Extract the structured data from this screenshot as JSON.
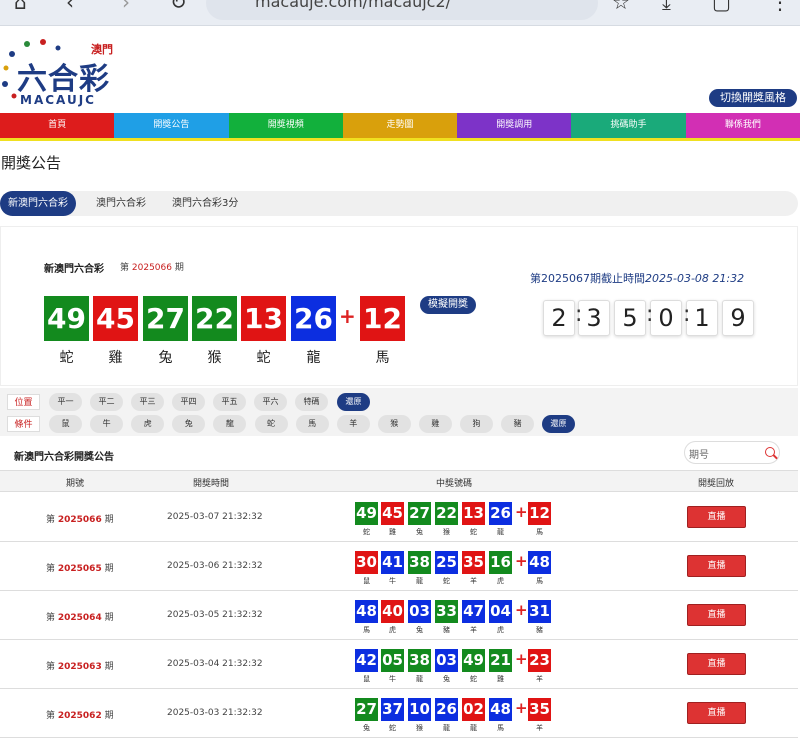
{
  "browser": {
    "url": "macauje.com/macaujc2/"
  },
  "logo": {
    "brand_cn": "六合彩",
    "region": "澳門",
    "brand_en": "MACAUJC"
  },
  "style_switch": "切換開獎風格",
  "nav": [
    {
      "label": "首頁",
      "color": "#dd1c1c"
    },
    {
      "label": "開獎公告",
      "color": "#1f9fe6"
    },
    {
      "label": "開獎視頻",
      "color": "#12b03c"
    },
    {
      "label": "走勢圖",
      "color": "#d9a00c"
    },
    {
      "label": "開獎調用",
      "color": "#7d33c8"
    },
    {
      "label": "挑碼助手",
      "color": "#1aaa7a"
    },
    {
      "label": "聯係我們",
      "color": "#d22fb4"
    }
  ],
  "page_title": "開獎公告",
  "tabs": [
    "新澳門六合彩",
    "澳門六合彩",
    "澳門六合彩3分"
  ],
  "current": {
    "lottery_name": "新澳門六合彩",
    "issue_prefix": "第",
    "issue": "2025066",
    "issue_suffix": "期",
    "balls": [
      {
        "num": "49",
        "zodiac": "蛇",
        "color": "#138a1e"
      },
      {
        "num": "45",
        "zodiac": "雞",
        "color": "#e01414"
      },
      {
        "num": "27",
        "zodiac": "兔",
        "color": "#138a1e"
      },
      {
        "num": "22",
        "zodiac": "猴",
        "color": "#138a1e"
      },
      {
        "num": "13",
        "zodiac": "蛇",
        "color": "#e01414"
      },
      {
        "num": "26",
        "zodiac": "龍",
        "color": "#0c2ee0"
      }
    ],
    "special": {
      "num": "12",
      "zodiac": "馬",
      "color": "#e01414"
    },
    "plus": "+",
    "simulate_label": "模擬開獎",
    "deadline_text": "第2025067期截止時間",
    "deadline_time": "2025-03-08 21:32",
    "countdown": [
      "2",
      "3",
      "5",
      "0",
      "1",
      "9"
    ]
  },
  "filters": {
    "position_label": "位置",
    "position_chips": [
      "平一",
      "平二",
      "平三",
      "平四",
      "平五",
      "平六",
      "特碼"
    ],
    "reset": "還原",
    "condition_label": "條件",
    "zodiac_chips": [
      "鼠",
      "牛",
      "虎",
      "兔",
      "龍",
      "蛇",
      "馬",
      "羊",
      "猴",
      "雞",
      "狗",
      "豬"
    ]
  },
  "list_title": "新澳門六合彩開獎公告",
  "search_placeholder": "期号",
  "table": {
    "headers": [
      "期號",
      "開獎時間",
      "中獎號碼",
      "開獎回放"
    ],
    "live_label": "直播",
    "rows": [
      {
        "issue": "2025066",
        "time": "2025-03-07 21:32:32",
        "balls": [
          [
            "49",
            "蛇",
            "#138a1e"
          ],
          [
            "45",
            "雞",
            "#e01414"
          ],
          [
            "27",
            "兔",
            "#138a1e"
          ],
          [
            "22",
            "猴",
            "#138a1e"
          ],
          [
            "13",
            "蛇",
            "#e01414"
          ],
          [
            "26",
            "龍",
            "#0c2ee0"
          ]
        ],
        "special": [
          "12",
          "馬",
          "#e01414"
        ]
      },
      {
        "issue": "2025065",
        "time": "2025-03-06 21:32:32",
        "balls": [
          [
            "30",
            "鼠",
            "#e01414"
          ],
          [
            "41",
            "牛",
            "#0c2ee0"
          ],
          [
            "38",
            "龍",
            "#138a1e"
          ],
          [
            "25",
            "蛇",
            "#0c2ee0"
          ],
          [
            "35",
            "羊",
            "#e01414"
          ],
          [
            "16",
            "虎",
            "#138a1e"
          ]
        ],
        "special": [
          "48",
          "馬",
          "#0c2ee0"
        ]
      },
      {
        "issue": "2025064",
        "time": "2025-03-05 21:32:32",
        "balls": [
          [
            "48",
            "馬",
            "#0c2ee0"
          ],
          [
            "40",
            "虎",
            "#e01414"
          ],
          [
            "03",
            "兔",
            "#0c2ee0"
          ],
          [
            "33",
            "豬",
            "#138a1e"
          ],
          [
            "47",
            "羊",
            "#0c2ee0"
          ],
          [
            "04",
            "虎",
            "#0c2ee0"
          ]
        ],
        "special": [
          "31",
          "豬",
          "#0c2ee0"
        ]
      },
      {
        "issue": "2025063",
        "time": "2025-03-04 21:32:32",
        "balls": [
          [
            "42",
            "鼠",
            "#0c2ee0"
          ],
          [
            "05",
            "牛",
            "#138a1e"
          ],
          [
            "38",
            "龍",
            "#138a1e"
          ],
          [
            "03",
            "兔",
            "#0c2ee0"
          ],
          [
            "49",
            "蛇",
            "#138a1e"
          ],
          [
            "21",
            "雞",
            "#138a1e"
          ]
        ],
        "special": [
          "23",
          "羊",
          "#e01414"
        ]
      },
      {
        "issue": "2025062",
        "time": "2025-03-03 21:32:32",
        "balls": [
          [
            "27",
            "兔",
            "#138a1e"
          ],
          [
            "37",
            "蛇",
            "#0c2ee0"
          ],
          [
            "10",
            "猴",
            "#0c2ee0"
          ],
          [
            "26",
            "龍",
            "#0c2ee0"
          ],
          [
            "02",
            "龍",
            "#e01414"
          ],
          [
            "48",
            "馬",
            "#0c2ee0"
          ]
        ],
        "special": [
          "35",
          "羊",
          "#e01414"
        ]
      }
    ]
  }
}
